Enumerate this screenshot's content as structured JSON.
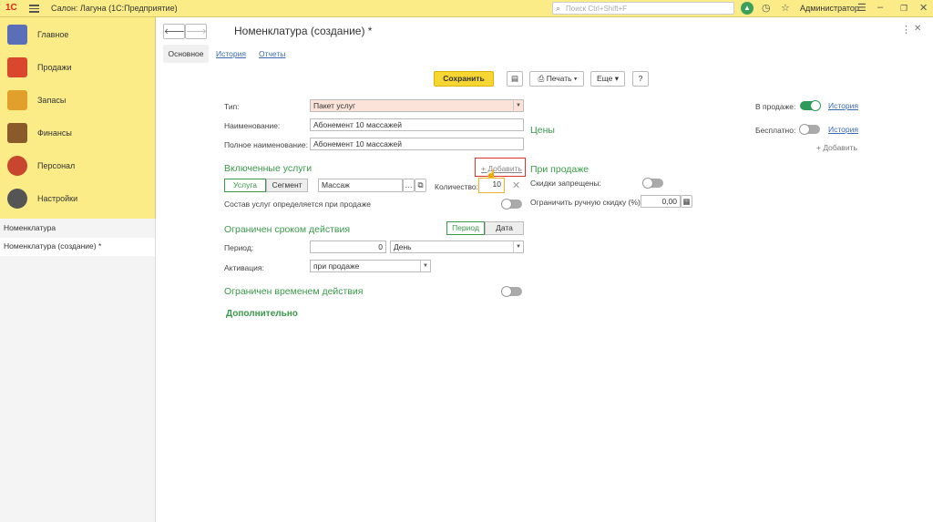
{
  "app": {
    "logo": "1С",
    "title": "Салон: Лагуна  (1С:Предприятие)",
    "search_placeholder": "Поиск Ctrl+Shift+F",
    "user": "Администратор"
  },
  "sidebar": {
    "items": [
      {
        "label": "Главное",
        "color": "#5b6fb8"
      },
      {
        "label": "Продажи",
        "color": "#d9482c"
      },
      {
        "label": "Запасы",
        "color": "#e0a02a"
      },
      {
        "label": "Финансы",
        "color": "#8a5a2a"
      },
      {
        "label": "Персонал",
        "color": "#c8462e"
      },
      {
        "label": "Настройки",
        "color": "#555555"
      }
    ],
    "open_windows": [
      "Номенклатура",
      "Номенклатура (создание) *"
    ]
  },
  "form": {
    "title": "Номенклатура (создание) *",
    "tabs": [
      "Основное",
      "История",
      "Отчеты"
    ],
    "toolbar": {
      "save": "Сохранить",
      "print": "Печать",
      "more": "Еще",
      "help": "?"
    },
    "type_label": "Тип:",
    "type_value": "Пакет услуг",
    "name_label": "Наименование:",
    "name_value": "Абонемент 10 массажей",
    "fullname_label": "Полное наименование:",
    "fullname_value": "Абонемент 10 массажей",
    "services_header": "Включенные услуги",
    "add_link": "+ Добавить",
    "seg_service": "Услуга",
    "seg_segment": "Сегмент",
    "service_value": "Массаж",
    "qty_label": "Количество:",
    "qty_value": "10",
    "composition_label": "Состав услуг определяется при продаже",
    "limited_term_header": "Ограничен сроком действия",
    "seg_period": "Период",
    "seg_date": "Дата",
    "period_label": "Период:",
    "period_value": "0",
    "period_unit": "День",
    "activation_label": "Активация:",
    "activation_value": "при продаже",
    "limited_time_header": "Ограничен временем действия",
    "additional_header": "Дополнительно"
  },
  "prices": {
    "on_sale_label": "В продаже:",
    "history_link": "История",
    "free_label": "Бесплатно:",
    "history_link2": "История",
    "add_link": "+ Добавить",
    "prices_header": "Цены",
    "at_sale_header": "При продаже",
    "discounts_label": "Скидки запрещены:",
    "manual_discount_label": "Ограничить ручную скидку (%):",
    "manual_discount_value": "0,00"
  }
}
